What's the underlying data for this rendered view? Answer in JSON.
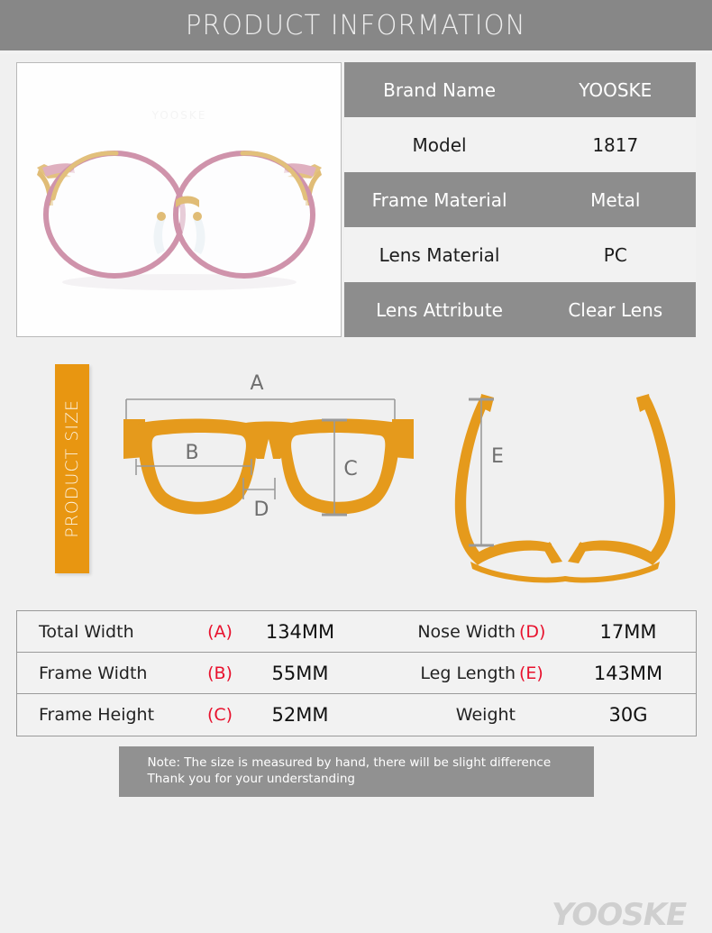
{
  "header": {
    "title": "PRODUCT INFORMATION"
  },
  "product_photo": {
    "alt": "pink metal round eyeglasses front view",
    "frame_color": "#d48fa8",
    "metal_color": "#e8c479"
  },
  "spec_table": {
    "rows": [
      {
        "label": "Brand Name",
        "value": "YOOSKE",
        "style": "dark"
      },
      {
        "label": "Model",
        "value": "1817",
        "style": "light"
      },
      {
        "label": "Frame Material",
        "value": "Metal",
        "style": "dark"
      },
      {
        "label": "Lens Material",
        "value": "PC",
        "style": "light"
      },
      {
        "label": "Lens Attribute",
        "value": "Clear Lens",
        "style": "dark"
      }
    ]
  },
  "size_section": {
    "banner_label": "PRODUCT SIZE",
    "banner_color": "#e89611",
    "diagram_color": "#e59a1c",
    "dimension_line_color": "#9a9a9a",
    "front_view_labels": [
      "A",
      "B",
      "C",
      "D"
    ],
    "top_view_labels": [
      "E"
    ],
    "watermark": "YOOSKE"
  },
  "measurements": {
    "rows": [
      {
        "left": {
          "name": "Total Width",
          "key": "(A)",
          "value": "134MM"
        },
        "right": {
          "name": "Nose Width",
          "key": "(D)",
          "value": "17MM"
        }
      },
      {
        "left": {
          "name": "Frame Width",
          "key": "(B)",
          "value": "55MM"
        },
        "right": {
          "name": "Leg Length",
          "key": "(E)",
          "value": "143MM"
        }
      },
      {
        "left": {
          "name": "Frame Height",
          "key": "(C)",
          "value": "52MM"
        },
        "right": {
          "name": "Weight",
          "key": "",
          "value": "30G"
        }
      }
    ]
  },
  "note": {
    "line1": "Note: The size is measured by hand, there will be slight difference",
    "line2": "Thank you for your understanding"
  }
}
